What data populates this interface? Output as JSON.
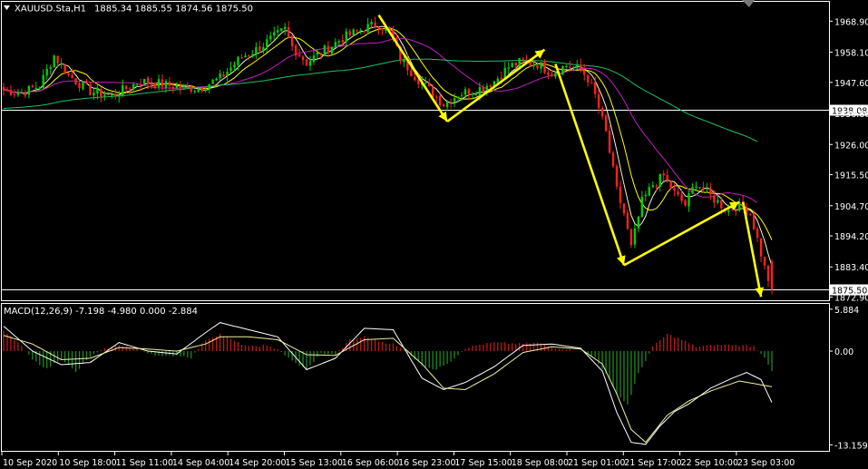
{
  "header": {
    "symbol_info": "XAUUSD.Sta,H1",
    "ohlc": "1885.34 1885.55 1874.56 1875.50",
    "menu_icon": "triangle-down-icon"
  },
  "colors": {
    "background": "#000000",
    "frame": "#ffffff",
    "bull": "#00d000",
    "bear": "#ff2020",
    "ma_fast": "#f5f5c8",
    "ma_mid": "#ffff00",
    "ma_slow": "#c020c0",
    "ma_long": "#20c060",
    "arrow": "#ffff00",
    "macd_pos": "#c01818",
    "macd_neg": "#1f8a1f",
    "signal": "#ffffff"
  },
  "chart_data": [
    {
      "type": "candlestick",
      "title": "XAUUSD.Sta,H1",
      "ohlc_last": {
        "open": 1885.34,
        "high": 1885.55,
        "low": 1874.56,
        "close": 1875.5
      },
      "y_ticks": [
        1968.9,
        1958.1,
        1947.6,
        1936.8,
        1926.0,
        1915.5,
        1904.7,
        1894.2,
        1883.4,
        1872.9
      ],
      "y_tick_labels": [
        "1968.90",
        "1958.10",
        "1947.60",
        "1936.80",
        "1926.00",
        "1915.50",
        "1904.70",
        "1894.20",
        "1883.40",
        "1872.90"
      ],
      "ylim": [
        1871.8,
        1975.0
      ],
      "horizontal_lines": [
        {
          "price": 1938.08,
          "label": "1938.08"
        },
        {
          "price": 1875.5,
          "label": "1875.50"
        }
      ],
      "x_tick_labels": [
        "10 Sep 2020",
        "10 Sep 18:00",
        "11 Sep 11:00",
        "14 Sep 04:00",
        "14 Sep 20:00",
        "15 Sep 13:00",
        "16 Sep 06:00",
        "16 Sep 23:00",
        "17 Sep 15:00",
        "18 Sep 08:00",
        "21 Sep 01:00",
        "21 Sep 17:00",
        "22 Sep 10:00",
        "23 Sep 03:00"
      ],
      "anchors": [
        [
          0,
          1945.0
        ],
        [
          5,
          1944.0
        ],
        [
          10,
          1946.5
        ],
        [
          14,
          1957.0
        ],
        [
          18,
          1950.0
        ],
        [
          24,
          1944.5
        ],
        [
          30,
          1943.0
        ],
        [
          38,
          1948.0
        ],
        [
          44,
          1947.0
        ],
        [
          48,
          1946.0
        ],
        [
          54,
          1945.5
        ],
        [
          60,
          1949.0
        ],
        [
          66,
          1956.5
        ],
        [
          70,
          1959.0
        ],
        [
          74,
          1962.5
        ],
        [
          78,
          1966.0
        ],
        [
          80,
          1960.0
        ],
        [
          84,
          1954.5
        ],
        [
          88,
          1958.0
        ],
        [
          94,
          1963.0
        ],
        [
          100,
          1966.5
        ],
        [
          104,
          1968.0
        ],
        [
          107,
          1965.0
        ],
        [
          110,
          1956.0
        ],
        [
          114,
          1950.0
        ],
        [
          118,
          1945.0
        ],
        [
          122,
          1940.0
        ],
        [
          126,
          1943.5
        ],
        [
          132,
          1945.5
        ],
        [
          136,
          1948.0
        ],
        [
          140,
          1953.0
        ],
        [
          144,
          1955.0
        ],
        [
          148,
          1954.0
        ],
        [
          152,
          1951.0
        ],
        [
          156,
          1953.5
        ],
        [
          160,
          1952.0
        ],
        [
          162,
          1949.0
        ],
        [
          164,
          1943.0
        ],
        [
          167,
          1930.0
        ],
        [
          170,
          1910.0
        ],
        [
          172,
          1902.0
        ],
        [
          174,
          1890.0
        ],
        [
          177,
          1906.0
        ],
        [
          180,
          1912.0
        ],
        [
          183,
          1915.0
        ],
        [
          186,
          1909.0
        ],
        [
          189,
          1905.0
        ],
        [
          192,
          1913.0
        ],
        [
          195,
          1909.0
        ],
        [
          198,
          1906.0
        ],
        [
          201,
          1903.0
        ],
        [
          203,
          1904.5
        ],
        [
          205,
          1904.0
        ],
        [
          207,
          1902.0
        ],
        [
          209,
          1893.0
        ],
        [
          211,
          1883.0
        ],
        [
          213,
          1875.5
        ]
      ],
      "arrows_drawn": [
        {
          "from_time_index": 104,
          "from_price": 1971.0,
          "to_time_index": 123,
          "to_price": 1934.0
        },
        {
          "from_time_index": 123,
          "from_price": 1934.0,
          "to_time_index": 150,
          "to_price": 1959.0
        },
        {
          "from_time_index": 153,
          "from_price": 1954.0,
          "to_time_index": 172,
          "to_price": 1884.0
        },
        {
          "from_time_index": 172,
          "from_price": 1884.0,
          "to_time_index": 204,
          "to_price": 1906.0
        },
        {
          "from_time_index": 205,
          "from_price": 1906.0,
          "to_time_index": 210,
          "to_price": 1873.0
        }
      ]
    },
    {
      "type": "bar",
      "title": "MACD(12,26,9) -7.198 -4.980 0.000 -2.884",
      "indicator_label": "MACD(12,26,9) -7.198 -4.980 0.000 -2.884",
      "y_tick_labels": [
        "5.884",
        "0.00",
        "-13.159"
      ],
      "y_ticks": [
        5.884,
        0.0,
        -13.159
      ],
      "ylim": [
        -14.0,
        6.5
      ],
      "histogram_anchors": [
        [
          0,
          2.8
        ],
        [
          4,
          1.2
        ],
        [
          8,
          -1.2
        ],
        [
          12,
          -2.5
        ],
        [
          16,
          -1.0
        ],
        [
          20,
          -3.0
        ],
        [
          24,
          -0.8
        ],
        [
          28,
          0.3
        ],
        [
          32,
          0.9
        ],
        [
          36,
          0.4
        ],
        [
          40,
          -0.2
        ],
        [
          44,
          -0.8
        ],
        [
          48,
          -0.6
        ],
        [
          52,
          -0.9
        ],
        [
          56,
          1.6
        ],
        [
          60,
          2.4
        ],
        [
          64,
          1.4
        ],
        [
          68,
          0.6
        ],
        [
          72,
          0.8
        ],
        [
          76,
          0.3
        ],
        [
          80,
          -1.4
        ],
        [
          84,
          -2.6
        ],
        [
          88,
          -0.3
        ],
        [
          92,
          -0.5
        ],
        [
          96,
          1.6
        ],
        [
          100,
          2.0
        ],
        [
          104,
          1.4
        ],
        [
          108,
          1.0
        ],
        [
          112,
          -0.2
        ],
        [
          116,
          -2.0
        ],
        [
          120,
          -2.6
        ],
        [
          124,
          -1.4
        ],
        [
          128,
          0.4
        ],
        [
          132,
          0.9
        ],
        [
          136,
          1.2
        ],
        [
          140,
          1.1
        ],
        [
          144,
          1.0
        ],
        [
          148,
          1.2
        ],
        [
          152,
          0.5
        ],
        [
          156,
          0.3
        ],
        [
          160,
          0.0
        ],
        [
          164,
          -0.9
        ],
        [
          167,
          -3.2
        ],
        [
          170,
          -6.0
        ],
        [
          173,
          -7.5
        ],
        [
          176,
          -3.2
        ],
        [
          180,
          0.6
        ],
        [
          184,
          2.4
        ],
        [
          188,
          1.6
        ],
        [
          192,
          0.6
        ],
        [
          196,
          0.8
        ],
        [
          200,
          0.9
        ],
        [
          204,
          0.8
        ],
        [
          208,
          0.7
        ],
        [
          211,
          -0.8
        ],
        [
          213,
          -2.9
        ]
      ],
      "signal_anchors": [
        [
          0,
          2.2
        ],
        [
          8,
          1.0
        ],
        [
          16,
          -1.2
        ],
        [
          24,
          -1.0
        ],
        [
          32,
          0.5
        ],
        [
          40,
          0.3
        ],
        [
          48,
          0.0
        ],
        [
          56,
          1.0
        ],
        [
          60,
          2.0
        ],
        [
          68,
          2.0
        ],
        [
          76,
          1.6
        ],
        [
          84,
          -0.5
        ],
        [
          92,
          -0.6
        ],
        [
          100,
          1.6
        ],
        [
          108,
          1.8
        ],
        [
          116,
          -1.8
        ],
        [
          122,
          -5.2
        ],
        [
          128,
          -5.4
        ],
        [
          136,
          -3.2
        ],
        [
          144,
          -0.2
        ],
        [
          152,
          0.6
        ],
        [
          160,
          0.3
        ],
        [
          166,
          -1.8
        ],
        [
          170,
          -6.0
        ],
        [
          174,
          -11.0
        ],
        [
          178,
          -12.8
        ],
        [
          184,
          -9.0
        ],
        [
          190,
          -7.0
        ],
        [
          196,
          -5.6
        ],
        [
          204,
          -4.2
        ],
        [
          213,
          -5.0
        ]
      ],
      "macd_anchors": [
        [
          0,
          3.5
        ],
        [
          8,
          0.0
        ],
        [
          16,
          -1.9
        ],
        [
          24,
          -1.6
        ],
        [
          32,
          1.2
        ],
        [
          40,
          0.0
        ],
        [
          48,
          -0.4
        ],
        [
          56,
          2.6
        ],
        [
          60,
          4.0
        ],
        [
          68,
          3.0
        ],
        [
          76,
          2.0
        ],
        [
          84,
          -2.6
        ],
        [
          92,
          -1.0
        ],
        [
          100,
          3.2
        ],
        [
          108,
          3.0
        ],
        [
          116,
          -3.8
        ],
        [
          122,
          -5.4
        ],
        [
          128,
          -4.4
        ],
        [
          136,
          -2.2
        ],
        [
          144,
          0.8
        ],
        [
          152,
          1.0
        ],
        [
          160,
          0.4
        ],
        [
          166,
          -2.8
        ],
        [
          170,
          -8.6
        ],
        [
          174,
          -12.8
        ],
        [
          178,
          -13.1
        ],
        [
          182,
          -10.5
        ],
        [
          186,
          -8.5
        ],
        [
          190,
          -7.4
        ],
        [
          196,
          -5.2
        ],
        [
          202,
          -3.8
        ],
        [
          206,
          -3.0
        ],
        [
          210,
          -4.0
        ],
        [
          213,
          -7.2
        ]
      ]
    }
  ]
}
